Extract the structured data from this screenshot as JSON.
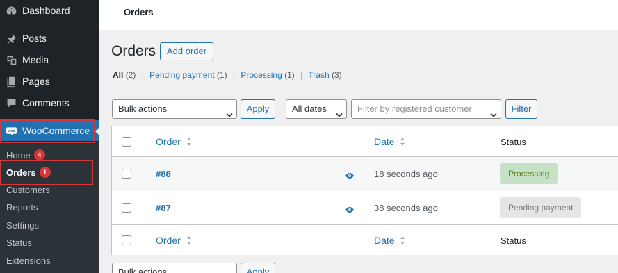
{
  "sidebar": {
    "items": [
      {
        "label": "Dashboard",
        "icon": "dashboard-icon"
      },
      {
        "label": "Posts",
        "icon": "pin-icon"
      },
      {
        "label": "Media",
        "icon": "media-icon"
      },
      {
        "label": "Pages",
        "icon": "pages-icon"
      },
      {
        "label": "Comments",
        "icon": "comment-icon"
      },
      {
        "label": "WooCommerce",
        "icon": "woo-icon"
      }
    ],
    "submenu": [
      {
        "label": "Home",
        "badge": "4"
      },
      {
        "label": "Orders",
        "badge": "1"
      },
      {
        "label": "Customers"
      },
      {
        "label": "Reports"
      },
      {
        "label": "Settings"
      },
      {
        "label": "Status"
      },
      {
        "label": "Extensions"
      }
    ]
  },
  "header": {
    "title": "Orders"
  },
  "page": {
    "title": "Orders",
    "add_button": "Add order"
  },
  "filters": {
    "all": {
      "label": "All",
      "count": "(2)"
    },
    "pending": {
      "label": "Pending payment",
      "count": "(1)"
    },
    "processing": {
      "label": "Processing",
      "count": "(1)"
    },
    "trash": {
      "label": "Trash",
      "count": "(3)"
    }
  },
  "toolbar": {
    "bulk_actions": "Bulk actions",
    "apply": "Apply",
    "dates": "All dates",
    "customer_placeholder": "Filter by registered customer",
    "filter": "Filter"
  },
  "table": {
    "columns": {
      "order": "Order",
      "date": "Date",
      "status": "Status"
    },
    "rows": [
      {
        "order": "#88",
        "date": "18 seconds ago",
        "status": "Processing"
      },
      {
        "order": "#87",
        "date": "38 seconds ago",
        "status": "Pending payment"
      }
    ]
  },
  "colors": {
    "accent": "#2271b1",
    "highlight_box": "#d63638",
    "processing_bg": "#c6e1c6",
    "pending_bg": "#e5e5e5"
  }
}
